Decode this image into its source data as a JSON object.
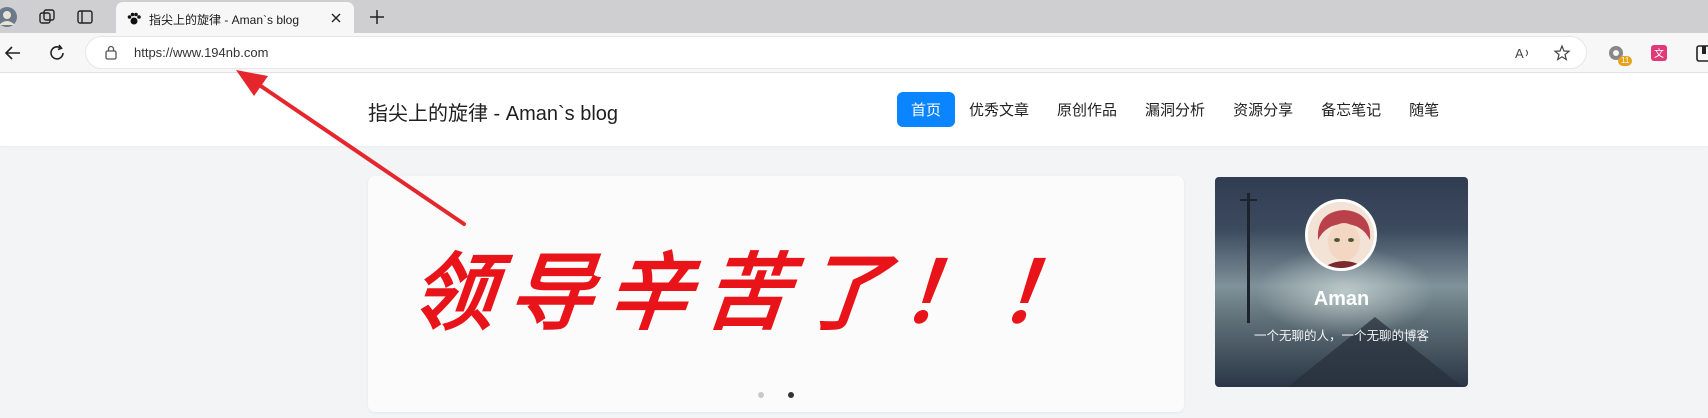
{
  "browser": {
    "tab_title": "指尖上的旋律 - Aman`s blog",
    "url": "https://www.194nb.com",
    "extension_badge": "11"
  },
  "site": {
    "title": "指尖上的旋律 - Aman`s blog",
    "nav": [
      {
        "label": "首页",
        "active": true
      },
      {
        "label": "优秀文章",
        "active": false
      },
      {
        "label": "原创作品",
        "active": false
      },
      {
        "label": "漏洞分析",
        "active": false
      },
      {
        "label": "资源分享",
        "active": false
      },
      {
        "label": "备忘笔记",
        "active": false
      },
      {
        "label": "随笔",
        "active": false
      }
    ],
    "banner_text": "领导辛苦了！！",
    "carousel": {
      "slides": 2,
      "current": 2
    },
    "profile": {
      "name": "Aman",
      "description": "一个无聊的人，一个无聊的博客"
    }
  },
  "colors": {
    "accent": "#0a84ff",
    "banner_red": "#e8141a",
    "arrow_red": "#e5262d"
  }
}
